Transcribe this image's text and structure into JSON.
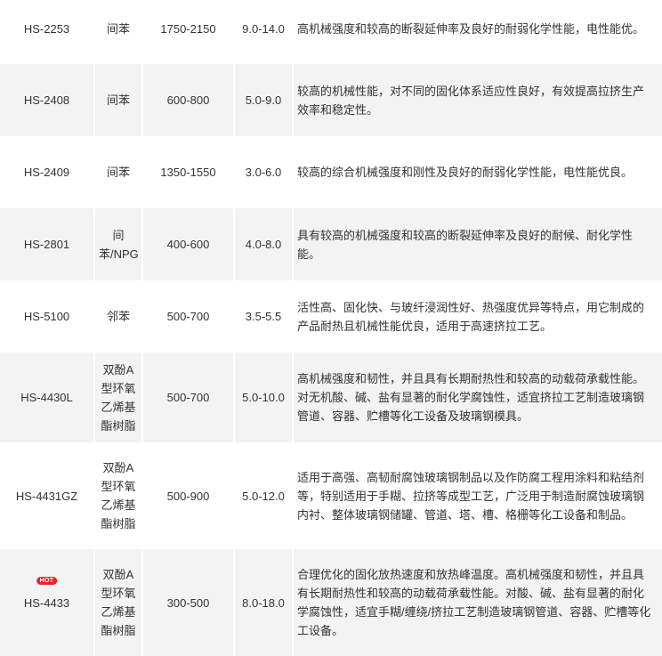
{
  "rows": [
    {
      "code": "HS-2253",
      "type": "间苯",
      "viscosity": "1750-2150",
      "solid": "9.0-14.0",
      "desc": "高机械强度和较高的断裂延伸率及良好的耐弱化学性能，电性能优。"
    },
    {
      "code": "HS-2408",
      "type": "间苯",
      "viscosity": "600-800",
      "solid": "5.0-9.0",
      "desc": "较高的机械性能，对不同的固化体系适应性良好，有效提高拉挤生产效率和稳定性。"
    },
    {
      "code": "HS-2409",
      "type": "间苯",
      "viscosity": "1350-1550",
      "solid": "3.0-6.0",
      "desc": "较高的综合机械强度和刚性及良好的耐弱化学性能，电性能优良。"
    },
    {
      "code": "HS-2801",
      "type": "间苯/NPG",
      "viscosity": "400-600",
      "solid": "4.0-8.0",
      "desc": "具有较高的机械强度和较高的断裂延伸率及良好的耐候、耐化学性能。"
    },
    {
      "code": "HS-5100",
      "type": "邻苯",
      "viscosity": "500-700",
      "solid": "3.5-5.5",
      "desc": "活性高、固化快、与玻纤浸润性好、热强度优异等特点，用它制成的产品耐热且机械性能优良，适用于高速挤拉工艺。"
    },
    {
      "code": "HS-4430L",
      "type": "双酚A型环氧乙烯基酯树脂",
      "viscosity": "500-700",
      "solid": "5.0-10.0",
      "desc": "高机械强度和韧性，并且具有长期耐热性和较高的动载荷承载性能。对无机酸、碱、盐有显著的耐化学腐蚀性，适宜挤拉工艺制造玻璃钢管道、容器、贮槽等化工设备及玻璃钢模具。"
    },
    {
      "code": "HS-4431GZ",
      "type": "双酚A型环氧乙烯基酯树脂",
      "viscosity": "500-900",
      "solid": "5.0-12.0",
      "desc": "适用于高强、高韧耐腐蚀玻璃钢制品以及作防腐工程用涂料和粘结剂等，特别适用于手糊、拉挤等成型工艺，广泛用于制造耐腐蚀玻璃钢内衬、整体玻璃钢储罐、管道、塔、槽、格栅等化工设备和制品。"
    },
    {
      "code": "HS-4433",
      "type": "双酚A型环氧乙烯基酯树脂",
      "viscosity": "300-500",
      "solid": "8.0-18.0",
      "badge": "HOT",
      "desc": "合理优化的固化放热速度和放热峰温度。高机械强度和韧性，并且具有长期耐热性和较高的动载荷承载性能。对酸、碱、盐有显著的耐化学腐蚀性，适宜手糊/缠绕/挤拉工艺制造玻璃钢管道、容器、贮槽等化工设备。"
    }
  ],
  "colors": {
    "row_alt": "#f3f3f3",
    "row": "#ffffff",
    "text": "#333333",
    "hot_badge": "#e8262a"
  }
}
